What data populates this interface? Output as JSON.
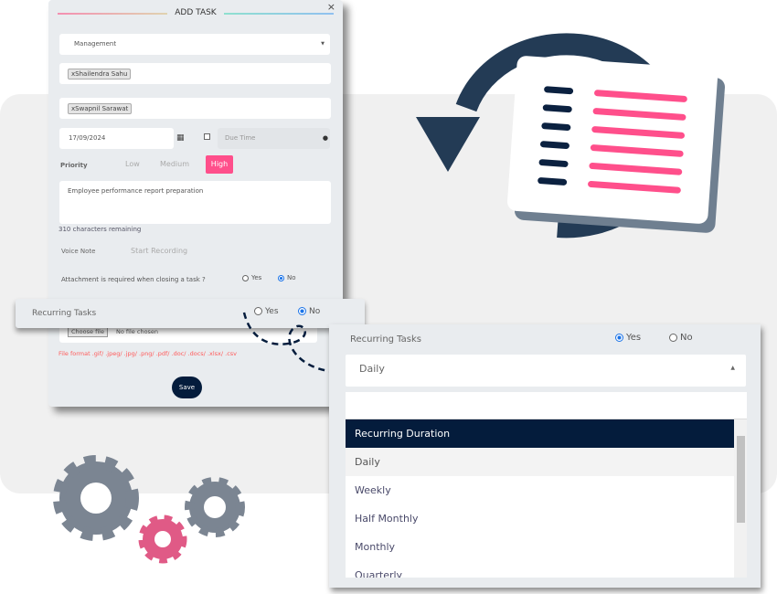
{
  "modal": {
    "title": "ADD TASK",
    "close": "×",
    "department": "Management",
    "assignee": "Shailendra Sahu",
    "observer": "Swapnil Sarawat",
    "date": "17/09/2024",
    "due_time_placeholder": "Due Time",
    "priority_label": "Priority",
    "priorities": [
      "Low",
      "Medium",
      "High"
    ],
    "selected_priority": "High",
    "description": "Employee performance report preparation",
    "chars_remaining": "310 characters remaining",
    "voice_note_label": "Voice Note",
    "start_recording": "Start Recording",
    "attachment_question": "Attachment is required when closing a task ?",
    "yes": "Yes",
    "no": "No",
    "choose_file": "Choose file",
    "no_file": "No file chosen",
    "file_format": "File format .gif/ .jpeg/ .jpg/ .png/ .pdf/ .doc/ .docs/ .xlsx/ .csv",
    "save": "Save"
  },
  "strip": {
    "label": "Recurring Tasks",
    "yes": "Yes",
    "no": "No",
    "selected": "No"
  },
  "panel": {
    "label": "Recurring Tasks",
    "yes": "Yes",
    "no": "No",
    "selected": "Yes",
    "value": "Daily",
    "options": [
      "Recurring Duration",
      "Daily",
      "Weekly",
      "Half Monthly",
      "Monthly",
      "Quarterly"
    ]
  },
  "colors": {
    "accent": "#ff4f8b",
    "navy": "#041c3c",
    "gear_gray": "#7b8592",
    "gear_pink": "#e05a86"
  }
}
